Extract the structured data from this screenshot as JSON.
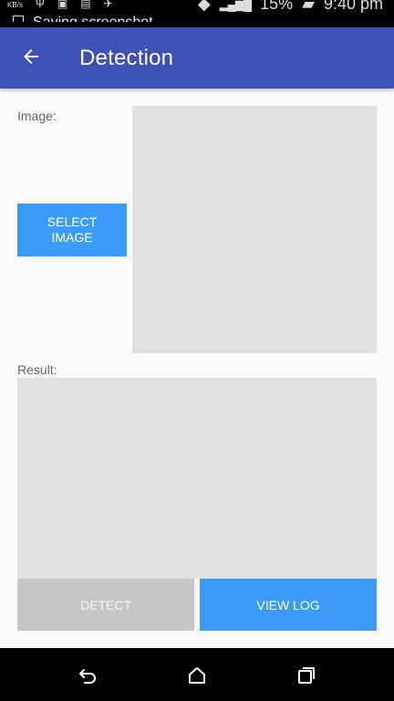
{
  "status_bar": {
    "speed_unit": "KB/s",
    "battery": "15%",
    "time": "9:40 pm"
  },
  "notification": {
    "text": "Saving screenshot"
  },
  "app_bar": {
    "title": "Detection"
  },
  "image_section": {
    "label": "Image:",
    "select_button": "SELECT IMAGE"
  },
  "result_section": {
    "label": "Result:"
  },
  "actions": {
    "detect": "DETECT",
    "view_log": "VIEW LOG"
  },
  "colors": {
    "app_bar": "#3f51b5",
    "primary_button": "#3d9bf8",
    "disabled_button": "#c6c6c6",
    "placeholder": "#e0e0e0"
  },
  "icons": {
    "back": "arrow-left-icon",
    "nav_back": "back-nav-icon",
    "nav_home": "home-nav-icon",
    "nav_recents": "recents-nav-icon"
  }
}
